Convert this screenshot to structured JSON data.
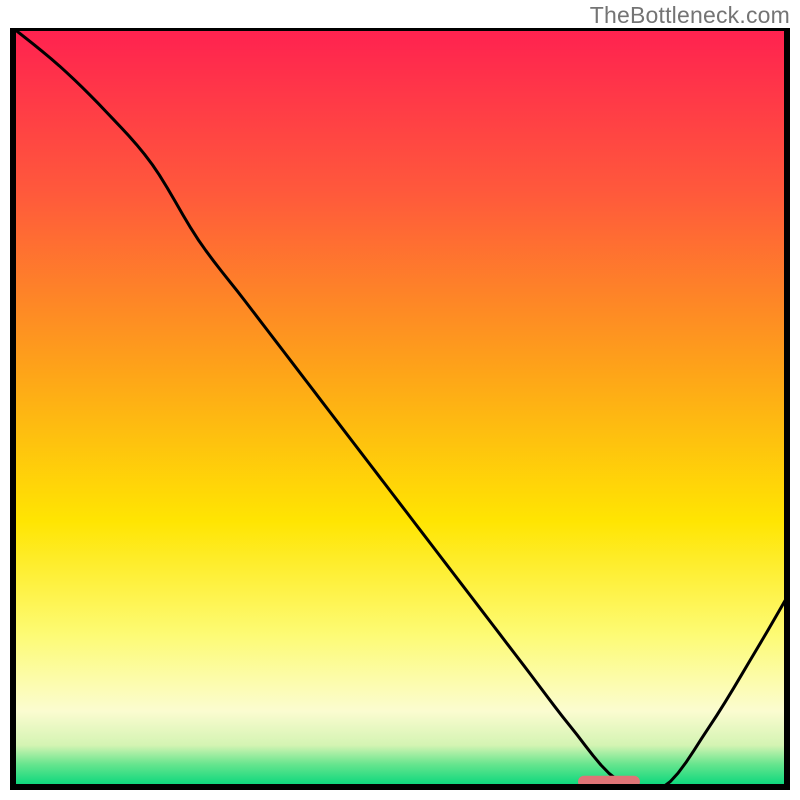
{
  "watermark": "TheBottleneck.com",
  "chart_data": {
    "type": "line",
    "title": "",
    "xlabel": "",
    "ylabel": "",
    "xlim": [
      0,
      100
    ],
    "ylim": [
      0,
      100
    ],
    "grid": false,
    "legend": false,
    "series": [
      {
        "name": "curve",
        "x": [
          0,
          6,
          12,
          18,
          24,
          30,
          36,
          42,
          48,
          54,
          60,
          66,
          72,
          78,
          84,
          90,
          96,
          100
        ],
        "values": [
          100,
          95,
          89,
          82,
          72,
          64,
          56,
          48,
          40,
          32,
          24,
          16,
          8,
          1,
          0,
          8,
          18,
          25
        ]
      }
    ],
    "marker": {
      "name": "optimal-marker",
      "x_center": 77,
      "y": 0.7,
      "width": 8,
      "color": "#df7577"
    },
    "background_gradient": {
      "stops": [
        {
          "offset": 0.0,
          "color": "#ff2150"
        },
        {
          "offset": 0.22,
          "color": "#ff5a3b"
        },
        {
          "offset": 0.45,
          "color": "#fea319"
        },
        {
          "offset": 0.65,
          "color": "#ffe502"
        },
        {
          "offset": 0.8,
          "color": "#fdfb75"
        },
        {
          "offset": 0.9,
          "color": "#fbfcd0"
        },
        {
          "offset": 0.945,
          "color": "#d4f4b3"
        },
        {
          "offset": 0.97,
          "color": "#67e58e"
        },
        {
          "offset": 1.0,
          "color": "#02d67b"
        }
      ]
    }
  }
}
